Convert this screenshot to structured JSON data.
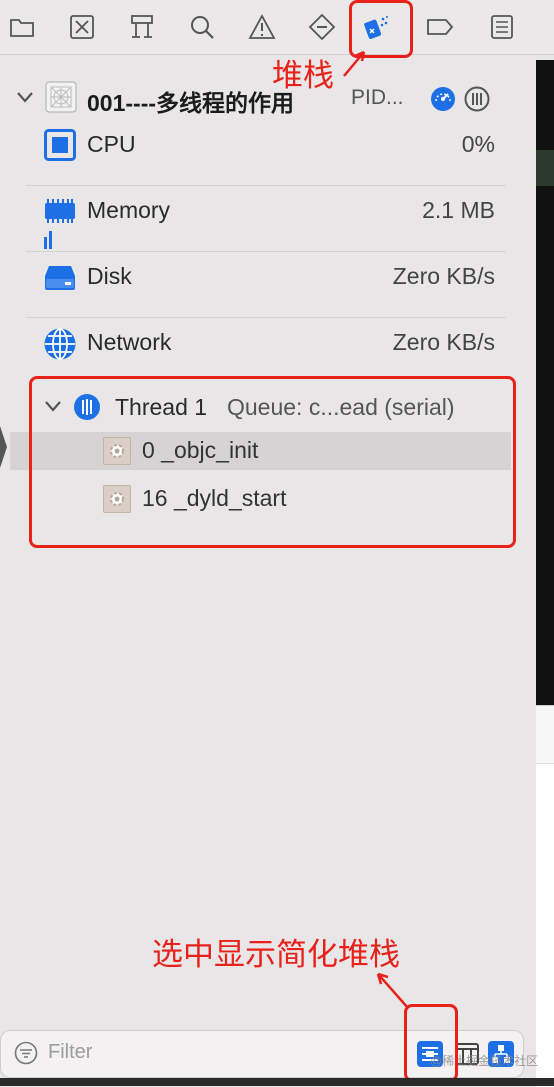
{
  "toolbar": {
    "icons": [
      "folder-icon",
      "source-control-icon",
      "hierarchy-icon",
      "search-icon",
      "warning-icon",
      "test-icon",
      "debug-navigator-icon",
      "breakpoint-icon",
      "report-icon"
    ]
  },
  "annotations": {
    "top": "堆栈",
    "bottom": "选中显示简化堆栈",
    "color": "#e8211a"
  },
  "process": {
    "title": "001----多线程的作用",
    "pid": "PID..."
  },
  "metrics": [
    {
      "label": "CPU",
      "value": "0%"
    },
    {
      "label": "Memory",
      "value": "2.1 MB"
    },
    {
      "label": "Disk",
      "value": "Zero KB/s"
    },
    {
      "label": "Network",
      "value": "Zero KB/s"
    }
  ],
  "thread": {
    "name": "Thread 1",
    "queue": "Queue: c...ead (serial)",
    "frames": [
      {
        "label": "0 _objc_init"
      },
      {
        "label": "16 _dyld_start"
      }
    ]
  },
  "filter": {
    "placeholder": "Filter"
  },
  "watermark": "@稀土掘金技术社区",
  "colors": {
    "accent": "#1d6fe6",
    "annotation": "#e8211a"
  }
}
